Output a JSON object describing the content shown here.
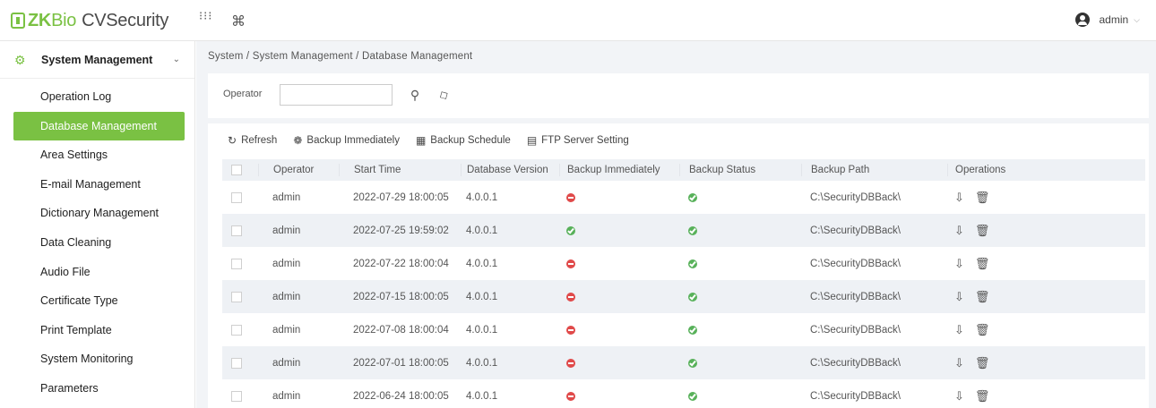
{
  "header": {
    "logo_zk": "ZK",
    "logo_bio": "Bio",
    "logo_cv": "CVSecurity",
    "apps_icon": "grid-icon",
    "shortcut_icon": "command-icon",
    "user_name": "admin"
  },
  "sidebar": {
    "module_label": "System Management",
    "items": [
      {
        "label": "Operation Log",
        "active": false
      },
      {
        "label": "Database Management",
        "active": true
      },
      {
        "label": "Area Settings",
        "active": false
      },
      {
        "label": "E-mail Management",
        "active": false
      },
      {
        "label": "Dictionary Management",
        "active": false
      },
      {
        "label": "Data Cleaning",
        "active": false
      },
      {
        "label": "Audio File",
        "active": false
      },
      {
        "label": "Certificate Type",
        "active": false
      },
      {
        "label": "Print Template",
        "active": false
      },
      {
        "label": "System Monitoring",
        "active": false
      },
      {
        "label": "Parameters",
        "active": false
      }
    ]
  },
  "breadcrumb": "System / System Management / Database Management",
  "search": {
    "operator_label": "Operator",
    "operator_value": ""
  },
  "toolbar": {
    "refresh": "Refresh",
    "backup_immediately": "Backup Immediately",
    "backup_schedule": "Backup Schedule",
    "ftp_server_setting": "FTP Server Setting"
  },
  "table": {
    "columns": [
      "Operator",
      "Start Time",
      "Database Version",
      "Backup Immediately",
      "Backup Status",
      "Backup Path",
      "Operations"
    ],
    "rows": [
      {
        "operator": "admin",
        "start_time": "2022-07-29 18:00:05",
        "version": "4.0.0.1",
        "backup_immediately": "no",
        "backup_status": "yes",
        "path": "C:\\SecurityDBBack\\"
      },
      {
        "operator": "admin",
        "start_time": "2022-07-25 19:59:02",
        "version": "4.0.0.1",
        "backup_immediately": "yes",
        "backup_status": "yes",
        "path": "C:\\SecurityDBBack\\"
      },
      {
        "operator": "admin",
        "start_time": "2022-07-22 18:00:04",
        "version": "4.0.0.1",
        "backup_immediately": "no",
        "backup_status": "yes",
        "path": "C:\\SecurityDBBack\\"
      },
      {
        "operator": "admin",
        "start_time": "2022-07-15 18:00:05",
        "version": "4.0.0.1",
        "backup_immediately": "no",
        "backup_status": "yes",
        "path": "C:\\SecurityDBBack\\"
      },
      {
        "operator": "admin",
        "start_time": "2022-07-08 18:00:04",
        "version": "4.0.0.1",
        "backup_immediately": "no",
        "backup_status": "yes",
        "path": "C:\\SecurityDBBack\\"
      },
      {
        "operator": "admin",
        "start_time": "2022-07-01 18:00:05",
        "version": "4.0.0.1",
        "backup_immediately": "no",
        "backup_status": "yes",
        "path": "C:\\SecurityDBBack\\"
      },
      {
        "operator": "admin",
        "start_time": "2022-06-24 18:00:05",
        "version": "4.0.0.1",
        "backup_immediately": "no",
        "backup_status": "yes",
        "path": "C:\\SecurityDBBack\\"
      }
    ]
  },
  "colors": {
    "brand": "#7ac143",
    "ok": "#58b15a",
    "fail": "#e04a4a"
  }
}
